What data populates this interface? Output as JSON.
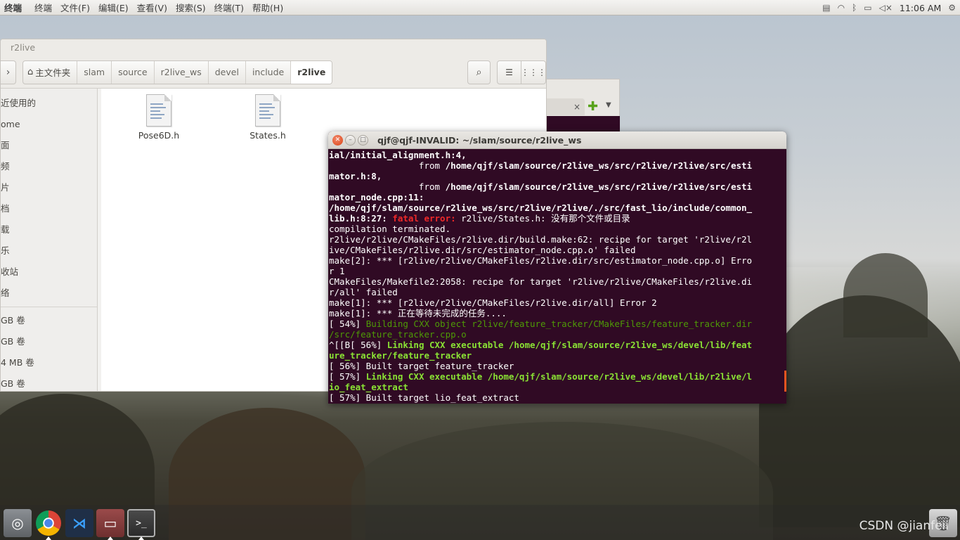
{
  "topbar": {
    "app_name": "终端",
    "menu": [
      "终端",
      "文件(F)",
      "编辑(E)",
      "查看(V)",
      "搜索(S)",
      "终端(T)",
      "帮助(H)"
    ],
    "clock": "11:06 AM"
  },
  "file_manager": {
    "title": "r2live",
    "breadcrumbs": {
      "home": "主文件夹",
      "items": [
        "slam",
        "source",
        "r2live_ws",
        "devel",
        "include"
      ],
      "active": "r2live"
    },
    "sidebar": [
      "近使用的",
      "ome",
      "面",
      "频",
      "片",
      "档",
      "载",
      "乐",
      "收站",
      "络",
      "GB 卷",
      "GB 卷",
      "4 MB 卷",
      "GB 卷"
    ],
    "files": [
      "Pose6D.h",
      "States.h"
    ]
  },
  "bg_window": {
    "tab_close": "×"
  },
  "terminal": {
    "title": "qjf@qjf-INVALID: ~/slam/source/r2live_ws",
    "lines": [
      [
        {
          "t": "ial/initial_alignment.h:4,",
          "c": "b"
        }
      ],
      [
        {
          "t": "                 from ",
          "c": ""
        },
        {
          "t": "/home/qjf/slam/source/r2live_ws/src/r2live/r2live/src/esti",
          "c": "b"
        }
      ],
      [
        {
          "t": "mator.h:8,",
          "c": "b"
        }
      ],
      [
        {
          "t": "                 from ",
          "c": ""
        },
        {
          "t": "/home/qjf/slam/source/r2live_ws/src/r2live/r2live/src/esti",
          "c": "b"
        }
      ],
      [
        {
          "t": "mator_node.cpp:11:",
          "c": "b"
        }
      ],
      [
        {
          "t": "/home/qjf/slam/source/r2live_ws/src/r2live/r2live/./src/fast_lio/include/common_",
          "c": "b"
        }
      ],
      [
        {
          "t": "lib.h:8:27: ",
          "c": "b"
        },
        {
          "t": "fatal error: ",
          "c": "red"
        },
        {
          "t": "r2live/States.h: 没有那个文件或目录",
          "c": ""
        }
      ],
      [
        {
          "t": "compilation terminated.",
          "c": ""
        }
      ],
      [
        {
          "t": "r2live/r2live/CMakeFiles/r2live.dir/build.make:62: recipe for target 'r2live/r2l",
          "c": ""
        }
      ],
      [
        {
          "t": "ive/CMakeFiles/r2live.dir/src/estimator_node.cpp.o' failed",
          "c": ""
        }
      ],
      [
        {
          "t": "make[2]: *** [r2live/r2live/CMakeFiles/r2live.dir/src/estimator_node.cpp.o] Erro",
          "c": ""
        }
      ],
      [
        {
          "t": "r 1",
          "c": ""
        }
      ],
      [
        {
          "t": "CMakeFiles/Makefile2:2058: recipe for target 'r2live/r2live/CMakeFiles/r2live.di",
          "c": ""
        }
      ],
      [
        {
          "t": "r/all' failed",
          "c": ""
        }
      ],
      [
        {
          "t": "make[1]: *** [r2live/r2live/CMakeFiles/r2live.dir/all] Error 2",
          "c": ""
        }
      ],
      [
        {
          "t": "make[1]: *** 正在等待未完成的任务....",
          "c": ""
        }
      ],
      [
        {
          "t": "[ 54%] ",
          "c": ""
        },
        {
          "t": "Building CXX object r2live/feature_tracker/CMakeFiles/feature_tracker.dir",
          "c": "grn"
        }
      ],
      [
        {
          "t": "/src/feature_tracker.cpp.o",
          "c": "grn"
        }
      ],
      [
        {
          "t": "^[[B[ 56%] ",
          "c": ""
        },
        {
          "t": "Linking CXX executable /home/qjf/slam/source/r2live_ws/devel/lib/feat",
          "c": "grnb"
        }
      ],
      [
        {
          "t": "ure_tracker/feature_tracker",
          "c": "grnb"
        }
      ],
      [
        {
          "t": "[ 56%] Built target feature_tracker",
          "c": ""
        }
      ],
      [
        {
          "t": "[ 57%] ",
          "c": ""
        },
        {
          "t": "Linking CXX executable /home/qjf/slam/source/r2live_ws/devel/lib/r2live/l",
          "c": "grnb"
        }
      ],
      [
        {
          "t": "io_feat_extract",
          "c": "grnb"
        }
      ],
      [
        {
          "t": "[ 57%] Built target lio_feat_extract",
          "c": ""
        }
      ]
    ]
  },
  "watermark": "CSDN @jianfeii"
}
